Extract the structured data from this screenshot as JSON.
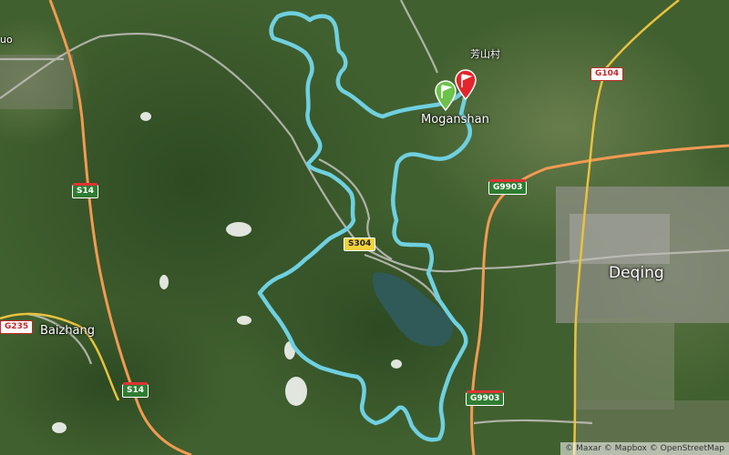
{
  "map": {
    "places": {
      "moganshan": "Moganshan",
      "deqing": "Deqing",
      "baizhang": "Baizhang",
      "fangshan_village": "芳山村",
      "partial_west": "uo"
    },
    "roads": {
      "s14_upper": "S14",
      "s14_lower": "S14",
      "s304": "S304",
      "g9903_upper": "G9903",
      "g9903_lower": "G9903",
      "g104": "G104",
      "g235": "G235"
    },
    "attribution": "© Maxar © Mapbox © OpenStreetMap",
    "markers": {
      "start": "start-flag-icon",
      "finish": "finish-flag-icon"
    },
    "colors": {
      "route": "#6fd0e0",
      "start_marker": "#6cc24a",
      "finish_marker": "#e3262b",
      "highway": "#f29a53",
      "primary_road": "#e8c23e"
    }
  }
}
